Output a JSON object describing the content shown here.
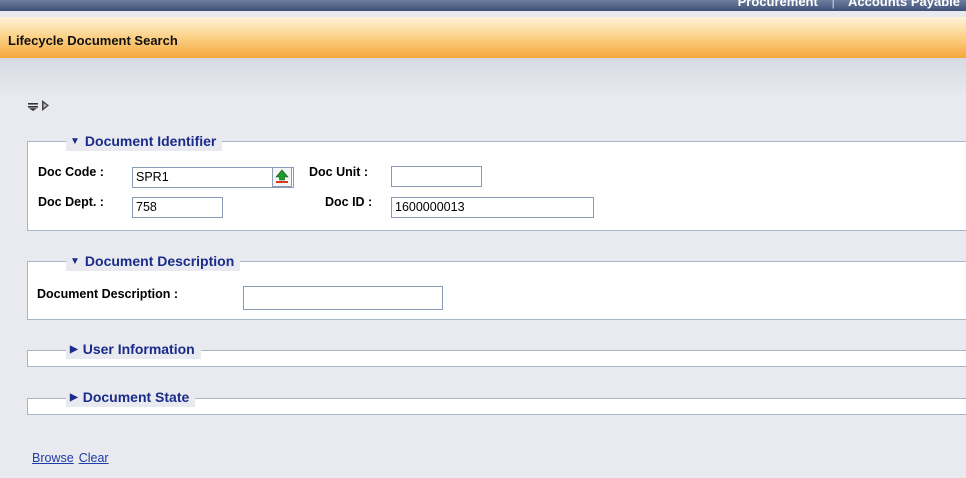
{
  "header": {
    "nav_links": [
      "Procurement",
      "Accounts Payable"
    ],
    "title": "Lifecycle Document Search"
  },
  "toolbar": {
    "icons": [
      "expand-all-icon",
      "collapse-all-icon"
    ]
  },
  "sections": {
    "document_identifier": {
      "title": "Document Identifier",
      "state": "expanded",
      "doc_code_label": "Doc Code :",
      "doc_code_value": "SPR1",
      "doc_unit_label": "Doc Unit :",
      "doc_unit_value": "",
      "doc_dept_label": "Doc Dept. :",
      "doc_dept_value": "758",
      "doc_id_label": "Doc ID :",
      "doc_id_value": "1600000013"
    },
    "document_description": {
      "title": "Document Description",
      "state": "expanded",
      "field_label": "Document Description :",
      "field_value": ""
    },
    "user_information": {
      "title": "User Information",
      "state": "collapsed"
    },
    "document_state": {
      "title": "Document State",
      "state": "collapsed"
    }
  },
  "actions": {
    "browse_label": "Browse",
    "clear_label": "Clear"
  },
  "colors": {
    "title_gradient_start": "#fff3dc",
    "title_gradient_end": "#f5a73b",
    "section_title": "#1b2b8a",
    "link": "#1f3da8",
    "background": "#e8eaef"
  }
}
